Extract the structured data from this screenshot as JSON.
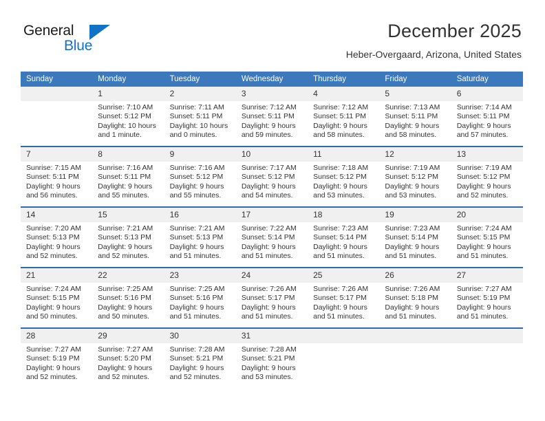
{
  "brand": {
    "name_line1": "General",
    "name_line2": "Blue",
    "logo_icon": "triangle-flag-icon",
    "accent_color": "#1272c5"
  },
  "header": {
    "title": "December 2025",
    "subtitle": "Heber-Overgaard, Arizona, United States"
  },
  "calendar": {
    "header_bg": "#3b79bc",
    "week_divider_color": "#2b6cb0",
    "daynum_bg": "#f0f0f0",
    "weekday_headers": [
      "Sunday",
      "Monday",
      "Tuesday",
      "Wednesday",
      "Thursday",
      "Friday",
      "Saturday"
    ],
    "weeks": [
      [
        {
          "day": "",
          "sunrise": "",
          "sunset": "",
          "daylight": "",
          "empty": true
        },
        {
          "day": "1",
          "sunrise": "Sunrise: 7:10 AM",
          "sunset": "Sunset: 5:12 PM",
          "daylight": "Daylight: 10 hours and 1 minute."
        },
        {
          "day": "2",
          "sunrise": "Sunrise: 7:11 AM",
          "sunset": "Sunset: 5:11 PM",
          "daylight": "Daylight: 10 hours and 0 minutes."
        },
        {
          "day": "3",
          "sunrise": "Sunrise: 7:12 AM",
          "sunset": "Sunset: 5:11 PM",
          "daylight": "Daylight: 9 hours and 59 minutes."
        },
        {
          "day": "4",
          "sunrise": "Sunrise: 7:12 AM",
          "sunset": "Sunset: 5:11 PM",
          "daylight": "Daylight: 9 hours and 58 minutes."
        },
        {
          "day": "5",
          "sunrise": "Sunrise: 7:13 AM",
          "sunset": "Sunset: 5:11 PM",
          "daylight": "Daylight: 9 hours and 58 minutes."
        },
        {
          "day": "6",
          "sunrise": "Sunrise: 7:14 AM",
          "sunset": "Sunset: 5:11 PM",
          "daylight": "Daylight: 9 hours and 57 minutes."
        }
      ],
      [
        {
          "day": "7",
          "sunrise": "Sunrise: 7:15 AM",
          "sunset": "Sunset: 5:11 PM",
          "daylight": "Daylight: 9 hours and 56 minutes."
        },
        {
          "day": "8",
          "sunrise": "Sunrise: 7:16 AM",
          "sunset": "Sunset: 5:11 PM",
          "daylight": "Daylight: 9 hours and 55 minutes."
        },
        {
          "day": "9",
          "sunrise": "Sunrise: 7:16 AM",
          "sunset": "Sunset: 5:12 PM",
          "daylight": "Daylight: 9 hours and 55 minutes."
        },
        {
          "day": "10",
          "sunrise": "Sunrise: 7:17 AM",
          "sunset": "Sunset: 5:12 PM",
          "daylight": "Daylight: 9 hours and 54 minutes."
        },
        {
          "day": "11",
          "sunrise": "Sunrise: 7:18 AM",
          "sunset": "Sunset: 5:12 PM",
          "daylight": "Daylight: 9 hours and 53 minutes."
        },
        {
          "day": "12",
          "sunrise": "Sunrise: 7:19 AM",
          "sunset": "Sunset: 5:12 PM",
          "daylight": "Daylight: 9 hours and 53 minutes."
        },
        {
          "day": "13",
          "sunrise": "Sunrise: 7:19 AM",
          "sunset": "Sunset: 5:12 PM",
          "daylight": "Daylight: 9 hours and 52 minutes."
        }
      ],
      [
        {
          "day": "14",
          "sunrise": "Sunrise: 7:20 AM",
          "sunset": "Sunset: 5:13 PM",
          "daylight": "Daylight: 9 hours and 52 minutes."
        },
        {
          "day": "15",
          "sunrise": "Sunrise: 7:21 AM",
          "sunset": "Sunset: 5:13 PM",
          "daylight": "Daylight: 9 hours and 52 minutes."
        },
        {
          "day": "16",
          "sunrise": "Sunrise: 7:21 AM",
          "sunset": "Sunset: 5:13 PM",
          "daylight": "Daylight: 9 hours and 51 minutes."
        },
        {
          "day": "17",
          "sunrise": "Sunrise: 7:22 AM",
          "sunset": "Sunset: 5:14 PM",
          "daylight": "Daylight: 9 hours and 51 minutes."
        },
        {
          "day": "18",
          "sunrise": "Sunrise: 7:23 AM",
          "sunset": "Sunset: 5:14 PM",
          "daylight": "Daylight: 9 hours and 51 minutes."
        },
        {
          "day": "19",
          "sunrise": "Sunrise: 7:23 AM",
          "sunset": "Sunset: 5:14 PM",
          "daylight": "Daylight: 9 hours and 51 minutes."
        },
        {
          "day": "20",
          "sunrise": "Sunrise: 7:24 AM",
          "sunset": "Sunset: 5:15 PM",
          "daylight": "Daylight: 9 hours and 51 minutes."
        }
      ],
      [
        {
          "day": "21",
          "sunrise": "Sunrise: 7:24 AM",
          "sunset": "Sunset: 5:15 PM",
          "daylight": "Daylight: 9 hours and 50 minutes."
        },
        {
          "day": "22",
          "sunrise": "Sunrise: 7:25 AM",
          "sunset": "Sunset: 5:16 PM",
          "daylight": "Daylight: 9 hours and 50 minutes."
        },
        {
          "day": "23",
          "sunrise": "Sunrise: 7:25 AM",
          "sunset": "Sunset: 5:16 PM",
          "daylight": "Daylight: 9 hours and 51 minutes."
        },
        {
          "day": "24",
          "sunrise": "Sunrise: 7:26 AM",
          "sunset": "Sunset: 5:17 PM",
          "daylight": "Daylight: 9 hours and 51 minutes."
        },
        {
          "day": "25",
          "sunrise": "Sunrise: 7:26 AM",
          "sunset": "Sunset: 5:17 PM",
          "daylight": "Daylight: 9 hours and 51 minutes."
        },
        {
          "day": "26",
          "sunrise": "Sunrise: 7:26 AM",
          "sunset": "Sunset: 5:18 PM",
          "daylight": "Daylight: 9 hours and 51 minutes."
        },
        {
          "day": "27",
          "sunrise": "Sunrise: 7:27 AM",
          "sunset": "Sunset: 5:19 PM",
          "daylight": "Daylight: 9 hours and 51 minutes."
        }
      ],
      [
        {
          "day": "28",
          "sunrise": "Sunrise: 7:27 AM",
          "sunset": "Sunset: 5:19 PM",
          "daylight": "Daylight: 9 hours and 52 minutes."
        },
        {
          "day": "29",
          "sunrise": "Sunrise: 7:27 AM",
          "sunset": "Sunset: 5:20 PM",
          "daylight": "Daylight: 9 hours and 52 minutes."
        },
        {
          "day": "30",
          "sunrise": "Sunrise: 7:28 AM",
          "sunset": "Sunset: 5:21 PM",
          "daylight": "Daylight: 9 hours and 52 minutes."
        },
        {
          "day": "31",
          "sunrise": "Sunrise: 7:28 AM",
          "sunset": "Sunset: 5:21 PM",
          "daylight": "Daylight: 9 hours and 53 minutes."
        },
        {
          "day": "",
          "sunrise": "",
          "sunset": "",
          "daylight": "",
          "empty": true
        },
        {
          "day": "",
          "sunrise": "",
          "sunset": "",
          "daylight": "",
          "empty": true
        },
        {
          "day": "",
          "sunrise": "",
          "sunset": "",
          "daylight": "",
          "empty": true
        }
      ]
    ]
  }
}
